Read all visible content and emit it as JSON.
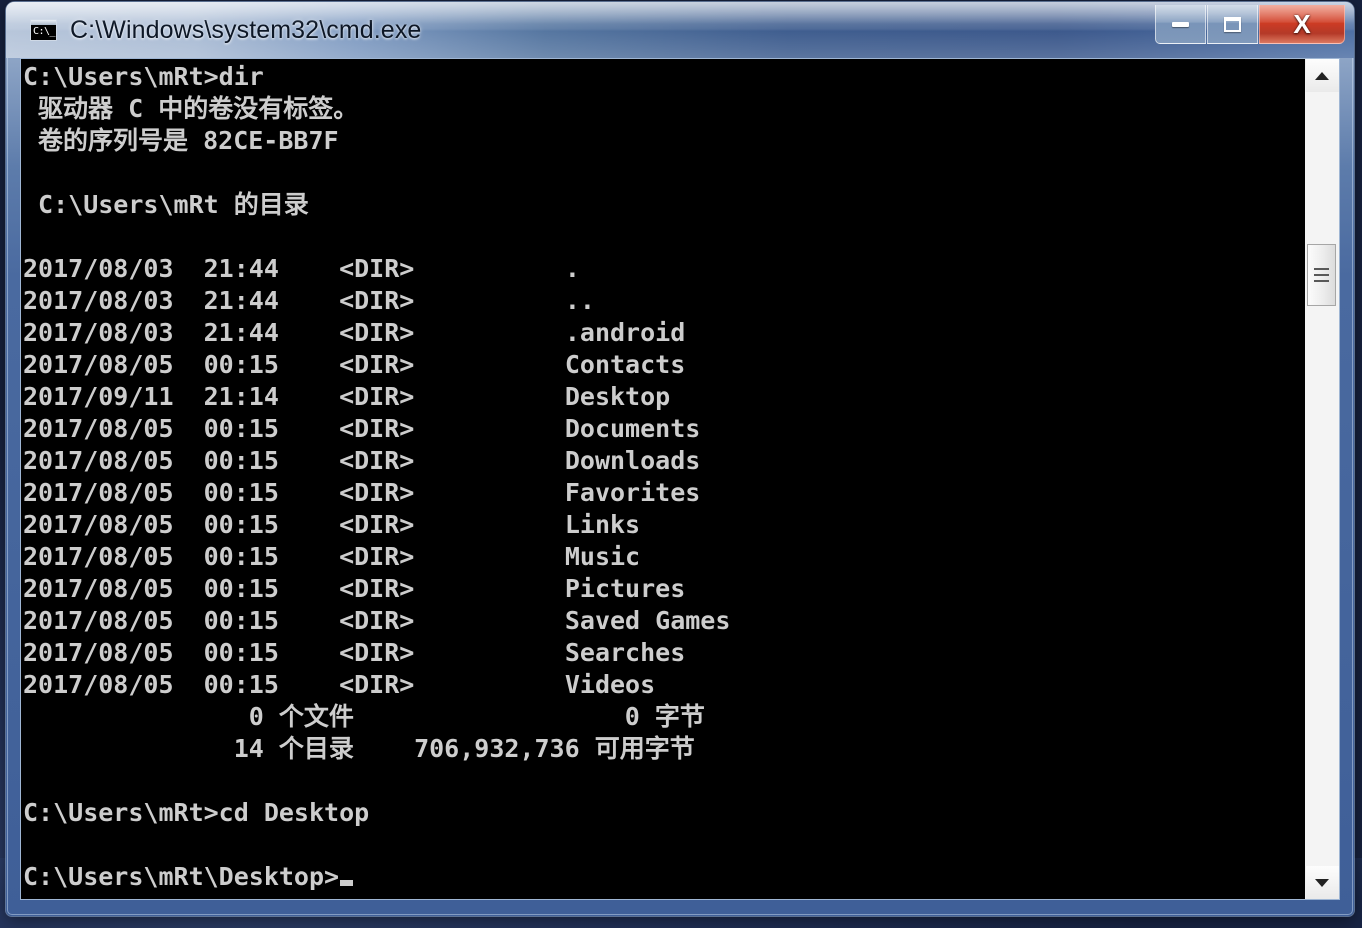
{
  "window": {
    "title": "C:\\Windows\\system32\\cmd.exe",
    "app_icon_glyph": "C:\\_",
    "controls": {
      "minimize_label": "–",
      "maximize_label": "□",
      "close_label": "X"
    },
    "colors": {
      "frame_blue": "#3f5f98",
      "title_light": "#b6c5da",
      "close_red": "#cf3a22",
      "console_bg": "#000000",
      "console_fg": "#cdcdcd"
    }
  },
  "console": {
    "prompt_1": "C:\\Users\\mRt>dir",
    "volume_label_line": " 驱动器 C 中的卷没有标签。",
    "volume_serial_line": " 卷的序列号是 82CE-BB7F",
    "directory_of_line": " C:\\Users\\mRt 的目录",
    "blank": "",
    "entries": [
      {
        "date": "2017/08/03",
        "time": "21:44",
        "type": "<DIR>",
        "name": "."
      },
      {
        "date": "2017/08/03",
        "time": "21:44",
        "type": "<DIR>",
        "name": ".."
      },
      {
        "date": "2017/08/03",
        "time": "21:44",
        "type": "<DIR>",
        "name": ".android"
      },
      {
        "date": "2017/08/05",
        "time": "00:15",
        "type": "<DIR>",
        "name": "Contacts"
      },
      {
        "date": "2017/09/11",
        "time": "21:14",
        "type": "<DIR>",
        "name": "Desktop"
      },
      {
        "date": "2017/08/05",
        "time": "00:15",
        "type": "<DIR>",
        "name": "Documents"
      },
      {
        "date": "2017/08/05",
        "time": "00:15",
        "type": "<DIR>",
        "name": "Downloads"
      },
      {
        "date": "2017/08/05",
        "time": "00:15",
        "type": "<DIR>",
        "name": "Favorites"
      },
      {
        "date": "2017/08/05",
        "time": "00:15",
        "type": "<DIR>",
        "name": "Links"
      },
      {
        "date": "2017/08/05",
        "time": "00:15",
        "type": "<DIR>",
        "name": "Music"
      },
      {
        "date": "2017/08/05",
        "time": "00:15",
        "type": "<DIR>",
        "name": "Pictures"
      },
      {
        "date": "2017/08/05",
        "time": "00:15",
        "type": "<DIR>",
        "name": "Saved Games"
      },
      {
        "date": "2017/08/05",
        "time": "00:15",
        "type": "<DIR>",
        "name": "Searches"
      },
      {
        "date": "2017/08/05",
        "time": "00:15",
        "type": "<DIR>",
        "name": "Videos"
      }
    ],
    "summary_files": "               0 个文件                  0 字节",
    "summary_dirs": "              14 个目录    706,932,736 可用字节",
    "prompt_2": "C:\\Users\\mRt>cd Desktop",
    "prompt_3": "C:\\Users\\mRt\\Desktop>",
    "file_count": "0",
    "file_word": "个文件",
    "bytes_count": "0",
    "bytes_word": "字节",
    "dir_count": "14",
    "dir_word": "个目录",
    "free_bytes": "706,932,736",
    "free_word": "可用字节"
  },
  "scrollbar": {
    "up_arrow": "scroll-up",
    "down_arrow": "scroll-down",
    "thumb": "scroll-thumb"
  }
}
